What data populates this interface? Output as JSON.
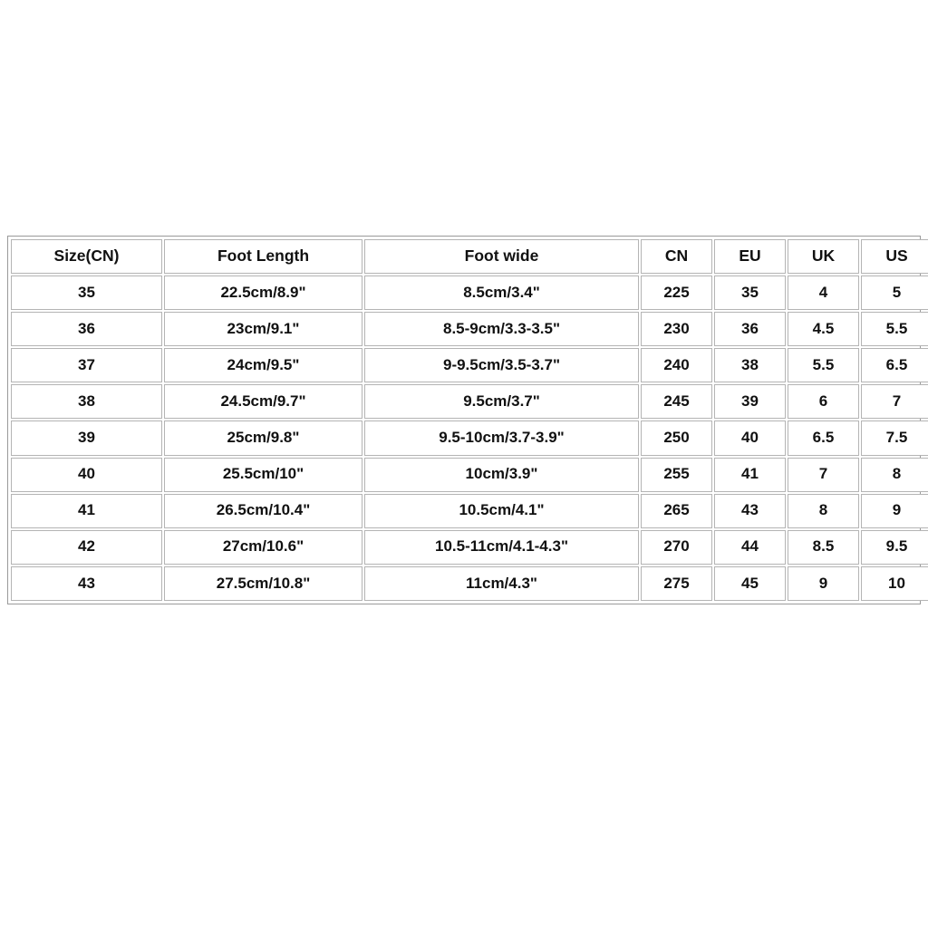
{
  "table": {
    "name": "shoe-size-conversion-chart",
    "columns": [
      {
        "key": "size_cn",
        "label": "Size(CN)"
      },
      {
        "key": "foot_length",
        "label": "Foot Length"
      },
      {
        "key": "foot_wide",
        "label": "Foot wide"
      },
      {
        "key": "cn",
        "label": "CN"
      },
      {
        "key": "eu",
        "label": "EU"
      },
      {
        "key": "uk",
        "label": "UK"
      },
      {
        "key": "us",
        "label": "US"
      }
    ],
    "rows": [
      {
        "size_cn": "35",
        "foot_length": "22.5cm/8.9\"",
        "foot_wide": "8.5cm/3.4\"",
        "cn": "225",
        "eu": "35",
        "uk": "4",
        "us": "5"
      },
      {
        "size_cn": "36",
        "foot_length": "23cm/9.1\"",
        "foot_wide": "8.5-9cm/3.3-3.5\"",
        "cn": "230",
        "eu": "36",
        "uk": "4.5",
        "us": "5.5"
      },
      {
        "size_cn": "37",
        "foot_length": "24cm/9.5\"",
        "foot_wide": "9-9.5cm/3.5-3.7\"",
        "cn": "240",
        "eu": "38",
        "uk": "5.5",
        "us": "6.5"
      },
      {
        "size_cn": "38",
        "foot_length": "24.5cm/9.7\"",
        "foot_wide": "9.5cm/3.7\"",
        "cn": "245",
        "eu": "39",
        "uk": "6",
        "us": "7"
      },
      {
        "size_cn": "39",
        "foot_length": "25cm/9.8\"",
        "foot_wide": "9.5-10cm/3.7-3.9\"",
        "cn": "250",
        "eu": "40",
        "uk": "6.5",
        "us": "7.5"
      },
      {
        "size_cn": "40",
        "foot_length": "25.5cm/10\"",
        "foot_wide": "10cm/3.9\"",
        "cn": "255",
        "eu": "41",
        "uk": "7",
        "us": "8"
      },
      {
        "size_cn": "41",
        "foot_length": "26.5cm/10.4\"",
        "foot_wide": "10.5cm/4.1\"",
        "cn": "265",
        "eu": "43",
        "uk": "8",
        "us": "9"
      },
      {
        "size_cn": "42",
        "foot_length": "27cm/10.6\"",
        "foot_wide": "10.5-11cm/4.1-4.3\"",
        "cn": "270",
        "eu": "44",
        "uk": "8.5",
        "us": "9.5"
      },
      {
        "size_cn": "43",
        "foot_length": "27.5cm/10.8\"",
        "foot_wide": "11cm/4.3\"",
        "cn": "275",
        "eu": "45",
        "uk": "9",
        "us": "10"
      }
    ]
  },
  "colors": {
    "page_background": "#ffffff",
    "cell_background": "#ffffff",
    "cell_border": "#b4b4b4",
    "outer_border": "#9a9a9a",
    "text": "#111111"
  }
}
